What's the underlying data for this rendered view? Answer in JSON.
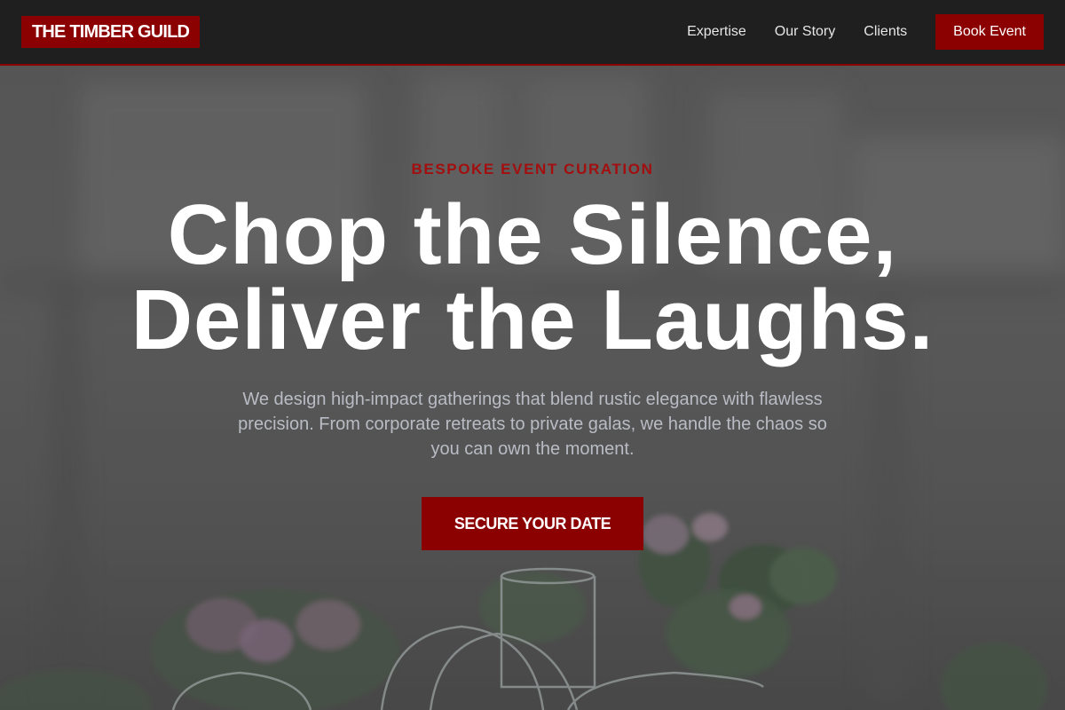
{
  "brand": {
    "name": "THE TIMBER GUILD"
  },
  "nav": {
    "links": [
      {
        "label": "Expertise"
      },
      {
        "label": "Our Story"
      },
      {
        "label": "Clients"
      }
    ],
    "cta_label": "Book Event"
  },
  "hero": {
    "eyebrow": "BESPOKE EVENT CURATION",
    "headline_line1": "Chop the Silence,",
    "headline_line2": "Deliver the Laughs.",
    "subtext": "We design high-impact gatherings that blend rustic elegance with flawless precision. From corporate retreats to private galas, we handle the chaos so you can own the moment.",
    "cta_label": "SECURE YOUR DATE"
  },
  "colors": {
    "accent": "#8b0000",
    "nav_background": "#1f1f1f",
    "eyebrow": "#a30f0f",
    "headline": "#ffffff",
    "subtext": "#b9bcc4"
  }
}
